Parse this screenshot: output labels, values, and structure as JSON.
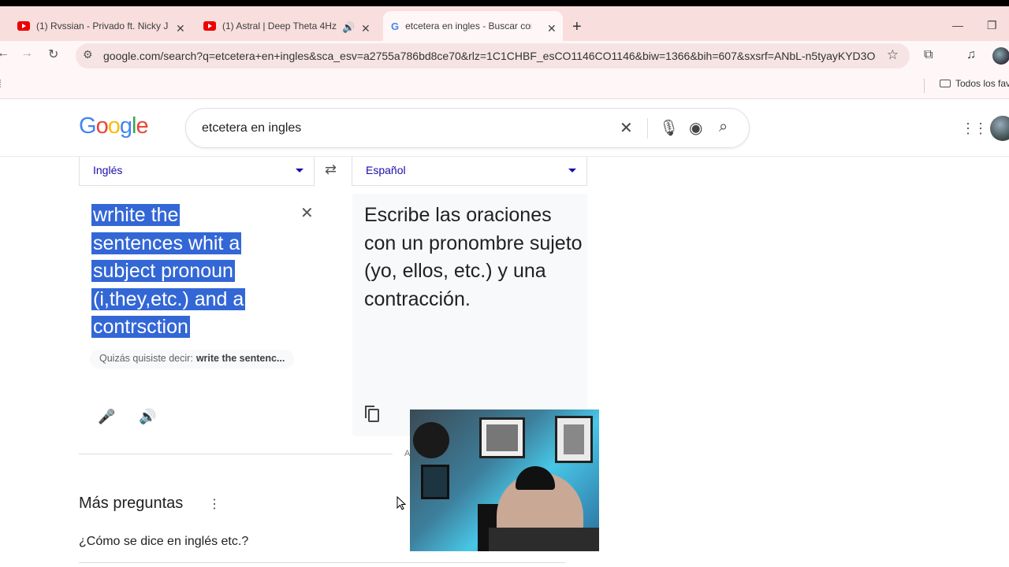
{
  "browser": {
    "tabs": [
      {
        "title": "(1) Rvssian - Privado ft. Nicky Ja",
        "icon": "youtube-icon"
      },
      {
        "title": "(1) Astral | Deep Theta 4Hz",
        "icon": "youtube-icon",
        "audio": true
      },
      {
        "title": "etcetera en ingles - Buscar con",
        "icon": "google-icon",
        "active": true
      }
    ],
    "url": "google.com/search?q=etcetera+en+ingles&sca_esv=a2755a786bd8ce70&rlz=1C1CHBF_esCO1146CO1146&biw=1366&bih=607&sxsrf=ANbL-n5tyayKYD3OD...",
    "bookmarks_folder": "Todos los fav"
  },
  "google": {
    "logo": "Google",
    "query": "etcetera en ingles"
  },
  "translate": {
    "source_lang": "Inglés",
    "target_lang": "Español",
    "source_lines": [
      "wrhite the",
      "sentences whit a",
      "subject pronoun",
      "(i,they,etc.) and a",
      "contrsction"
    ],
    "target_text": "Escribe las oraciones con un pronombre sujeto (yo, ellos, etc.) y una contracción.",
    "did_you_mean_label": "Quizás quisiste decir:",
    "did_you_mean_value": "write the sentenc...",
    "partial_hint": "A"
  },
  "more_questions": {
    "title": "Más preguntas",
    "items": [
      "¿Cómo se dice en inglés etc.?"
    ]
  },
  "colors": {
    "selection": "#3367d6",
    "link": "#1a0dab",
    "tabstrip": "#f9dede"
  }
}
